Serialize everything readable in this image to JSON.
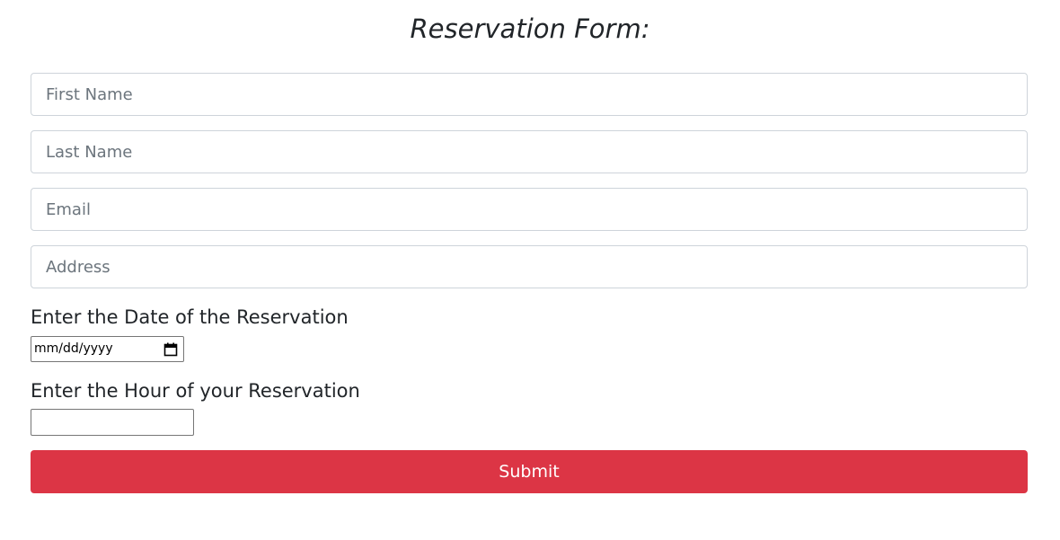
{
  "form": {
    "title": "Reservation Form:",
    "first_name_placeholder": "First Name",
    "last_name_placeholder": "Last Name",
    "email_placeholder": "Email",
    "address_placeholder": "Address",
    "date_label": "Enter the Date of the Reservation",
    "date_placeholder": "mm/dd/yyyy",
    "hour_label": "Enter the Hour of your Reservation",
    "hour_value": "",
    "submit_label": "Submit"
  },
  "colors": {
    "submit_bg": "#dc3545",
    "input_border": "#ced4da",
    "text": "#212529"
  },
  "icons": {
    "date_picker": "calendar-icon"
  }
}
